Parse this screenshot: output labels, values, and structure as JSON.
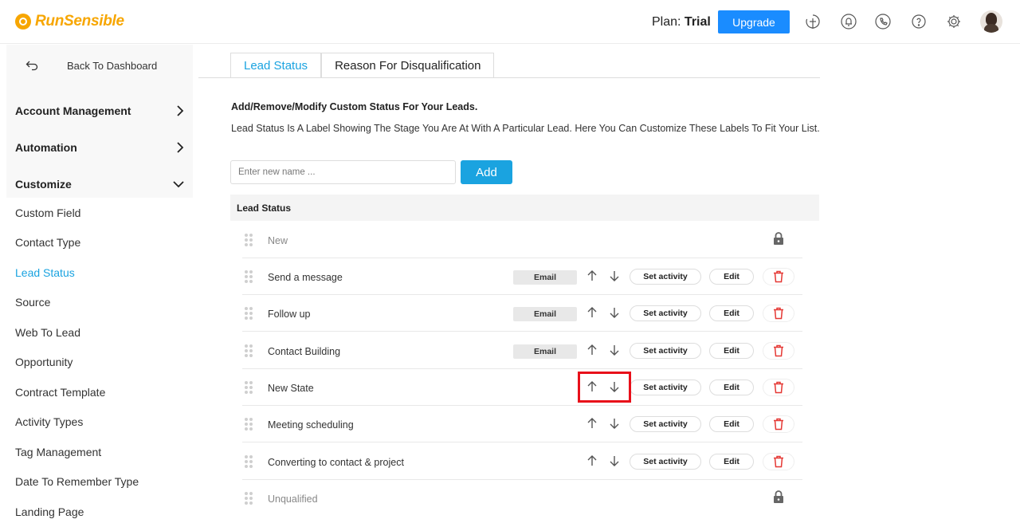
{
  "header": {
    "brand": "RunSensible",
    "plan_label": "Plan:",
    "plan_value": "Trial",
    "upgrade_label": "Upgrade",
    "icons": [
      "add-circle-icon",
      "notification-bell-icon",
      "phone-icon",
      "help-icon",
      "settings-gear-icon",
      "user-avatar"
    ],
    "accent_color": "#1a8cff",
    "brand_color": "#f7a600"
  },
  "sidebar": {
    "back_label": "Back To Dashboard",
    "sections": [
      {
        "label": "Account Management",
        "state": "collapsed"
      },
      {
        "label": "Automation",
        "state": "collapsed"
      },
      {
        "label": "Customize",
        "state": "expanded"
      }
    ],
    "items": [
      {
        "label": "Custom Field"
      },
      {
        "label": "Contact Type"
      },
      {
        "label": "Lead Status",
        "active": true
      },
      {
        "label": "Source"
      },
      {
        "label": "Web To Lead"
      },
      {
        "label": "Opportunity"
      },
      {
        "label": "Contract Template"
      },
      {
        "label": "Activity Types"
      },
      {
        "label": "Tag Management"
      },
      {
        "label": "Date To Remember Type"
      },
      {
        "label": "Landing Page"
      }
    ],
    "active_color": "#1aa3e0"
  },
  "tabs": [
    {
      "label": "Lead Status",
      "active": true
    },
    {
      "label": "Reason For Disqualification",
      "active": false
    }
  ],
  "content": {
    "heading": "Add/Remove/Modify Custom Status For Your Leads.",
    "description": "Lead Status Is A Label Showing The Stage You Are At With A Particular Lead. Here You Can Customize These Labels To Fit Your List.",
    "input_placeholder": "Enter new name ...",
    "add_label": "Add",
    "list_header": "Lead Status",
    "email_label": "Email",
    "set_activity_label": "Set activity",
    "edit_label": "Edit",
    "statuses": [
      {
        "name": "New",
        "locked": true
      },
      {
        "name": "Send a message",
        "email": true
      },
      {
        "name": "Follow up",
        "email": true
      },
      {
        "name": "Contact Building",
        "email": true
      },
      {
        "name": "New State",
        "highlighted": true
      },
      {
        "name": "Meeting scheduling"
      },
      {
        "name": "Converting to contact & project"
      },
      {
        "name": "Unqualified",
        "locked": true
      }
    ],
    "delete_color": "#e53935",
    "highlight_color": "#e8101a"
  }
}
